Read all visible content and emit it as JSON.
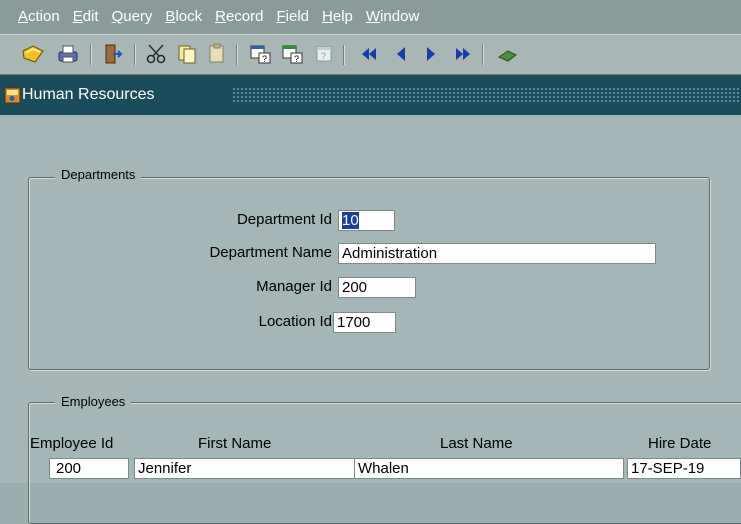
{
  "menu": [
    "Action",
    "Edit",
    "Query",
    "Block",
    "Record",
    "Field",
    "Help",
    "Window"
  ],
  "toolbar": {
    "icons": [
      "save-icon",
      "print-icon",
      "exit-icon",
      "cut-icon",
      "copy-icon",
      "paste-icon",
      "enter-query-icon",
      "execute-query-icon",
      "cancel-query-icon",
      "first-record-icon",
      "previous-record-icon",
      "next-record-icon",
      "last-record-icon",
      "insert-record-icon"
    ]
  },
  "window": {
    "title": "Human Resources"
  },
  "departments": {
    "title": "Departments",
    "department_id_label": "Department Id",
    "department_id_value": "10",
    "department_name_label": "Department Name",
    "department_name_value": "Administration",
    "manager_id_label": "Manager Id",
    "manager_id_value": "200",
    "location_id_label": "Location Id",
    "location_id_value": "1700"
  },
  "employees": {
    "title": "Employees",
    "columns": [
      "Employee Id",
      "First Name",
      "Last Name",
      "Hire Date"
    ],
    "rows": [
      {
        "employee_id": "200",
        "first_name": "Jennifer",
        "last_name": "Whalen",
        "hire_date": "17-SEP-19"
      }
    ]
  },
  "colors": {
    "selection": "#1b3fa0",
    "title_bar": "#1b4c5c",
    "background": "#a4b6b5"
  }
}
